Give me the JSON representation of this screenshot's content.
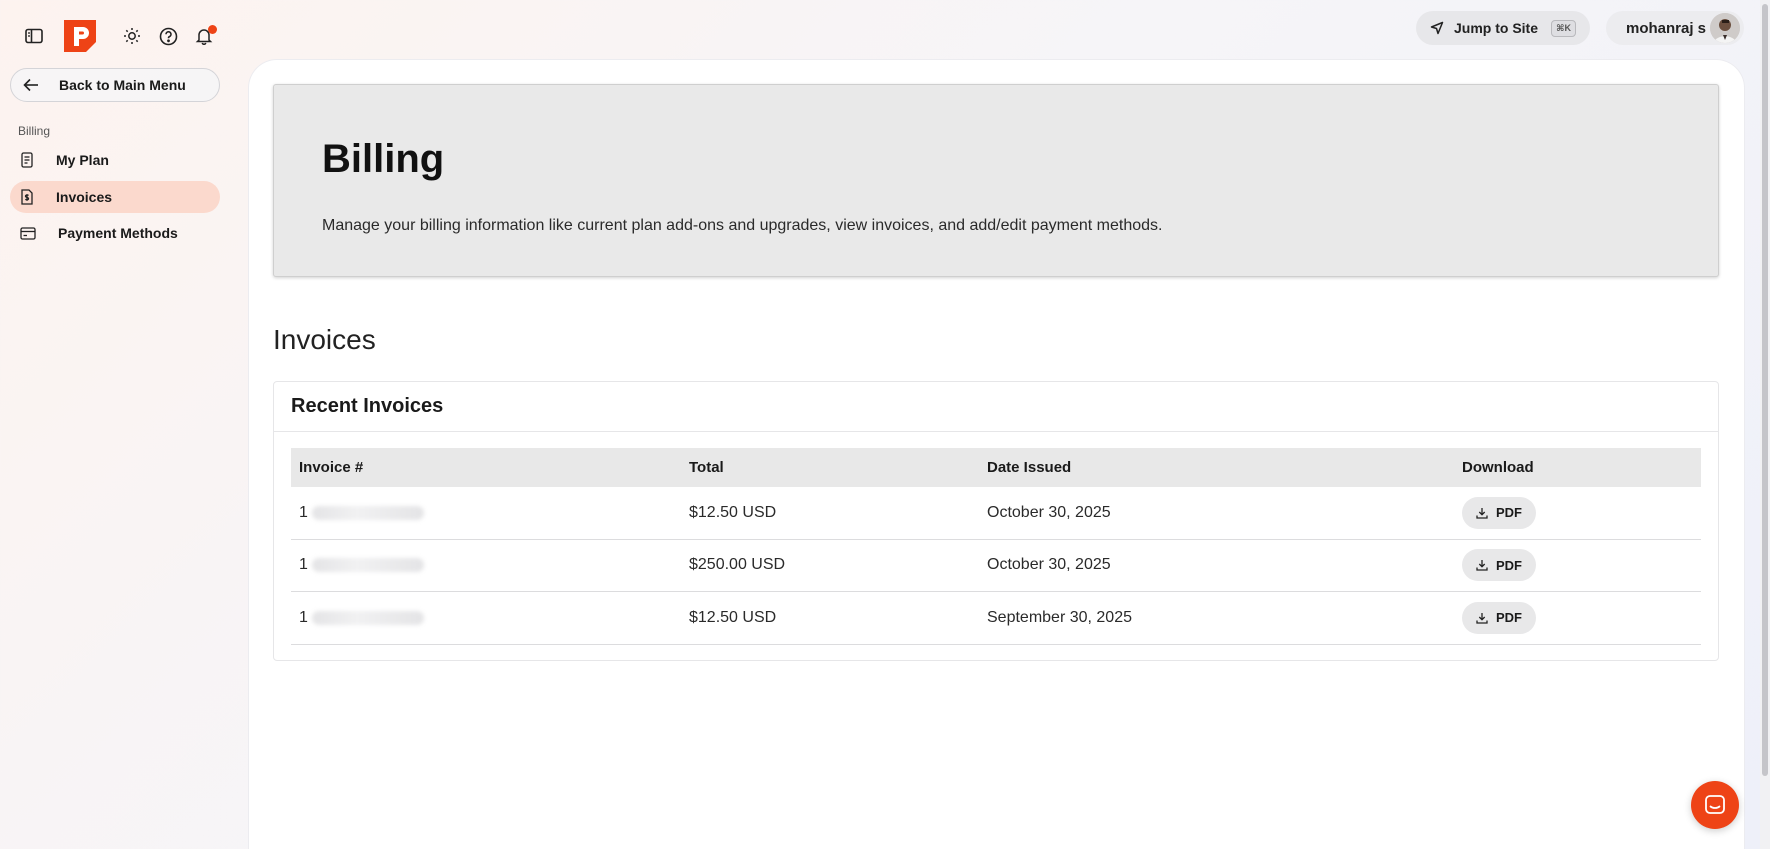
{
  "topbar": {
    "jump_label": "Jump to Site",
    "jump_shortcut": "⌘K",
    "user_name": "mohanraj s"
  },
  "sidebar": {
    "back_label": "Back to Main Menu",
    "section_label": "Billing",
    "items": [
      {
        "label": "My Plan",
        "icon": "document-icon",
        "active": false
      },
      {
        "label": "Invoices",
        "icon": "invoice-icon",
        "active": true
      },
      {
        "label": "Payment Methods",
        "icon": "credit-card-icon",
        "active": false
      }
    ]
  },
  "hero": {
    "title": "Billing",
    "description": "Manage your billing information like current plan add-ons and upgrades, view invoices, and add/edit payment methods."
  },
  "invoices": {
    "section_title": "Invoices",
    "card_title": "Recent Invoices",
    "columns": [
      "Invoice #",
      "Total",
      "Date Issued",
      "Download"
    ],
    "rows": [
      {
        "invoice_prefix": "1",
        "total": "$12.50 USD",
        "date": "October 30, 2025",
        "download": "PDF"
      },
      {
        "invoice_prefix": "1",
        "total": "$250.00 USD",
        "date": "October 30, 2025",
        "download": "PDF"
      },
      {
        "invoice_prefix": "1",
        "total": "$12.50 USD",
        "date": "September 30, 2025",
        "download": "PDF"
      }
    ]
  },
  "colors": {
    "accent": "#ee4316",
    "active_nav_bg": "#fbd9cd",
    "hero_bg": "#e9e9e9"
  }
}
